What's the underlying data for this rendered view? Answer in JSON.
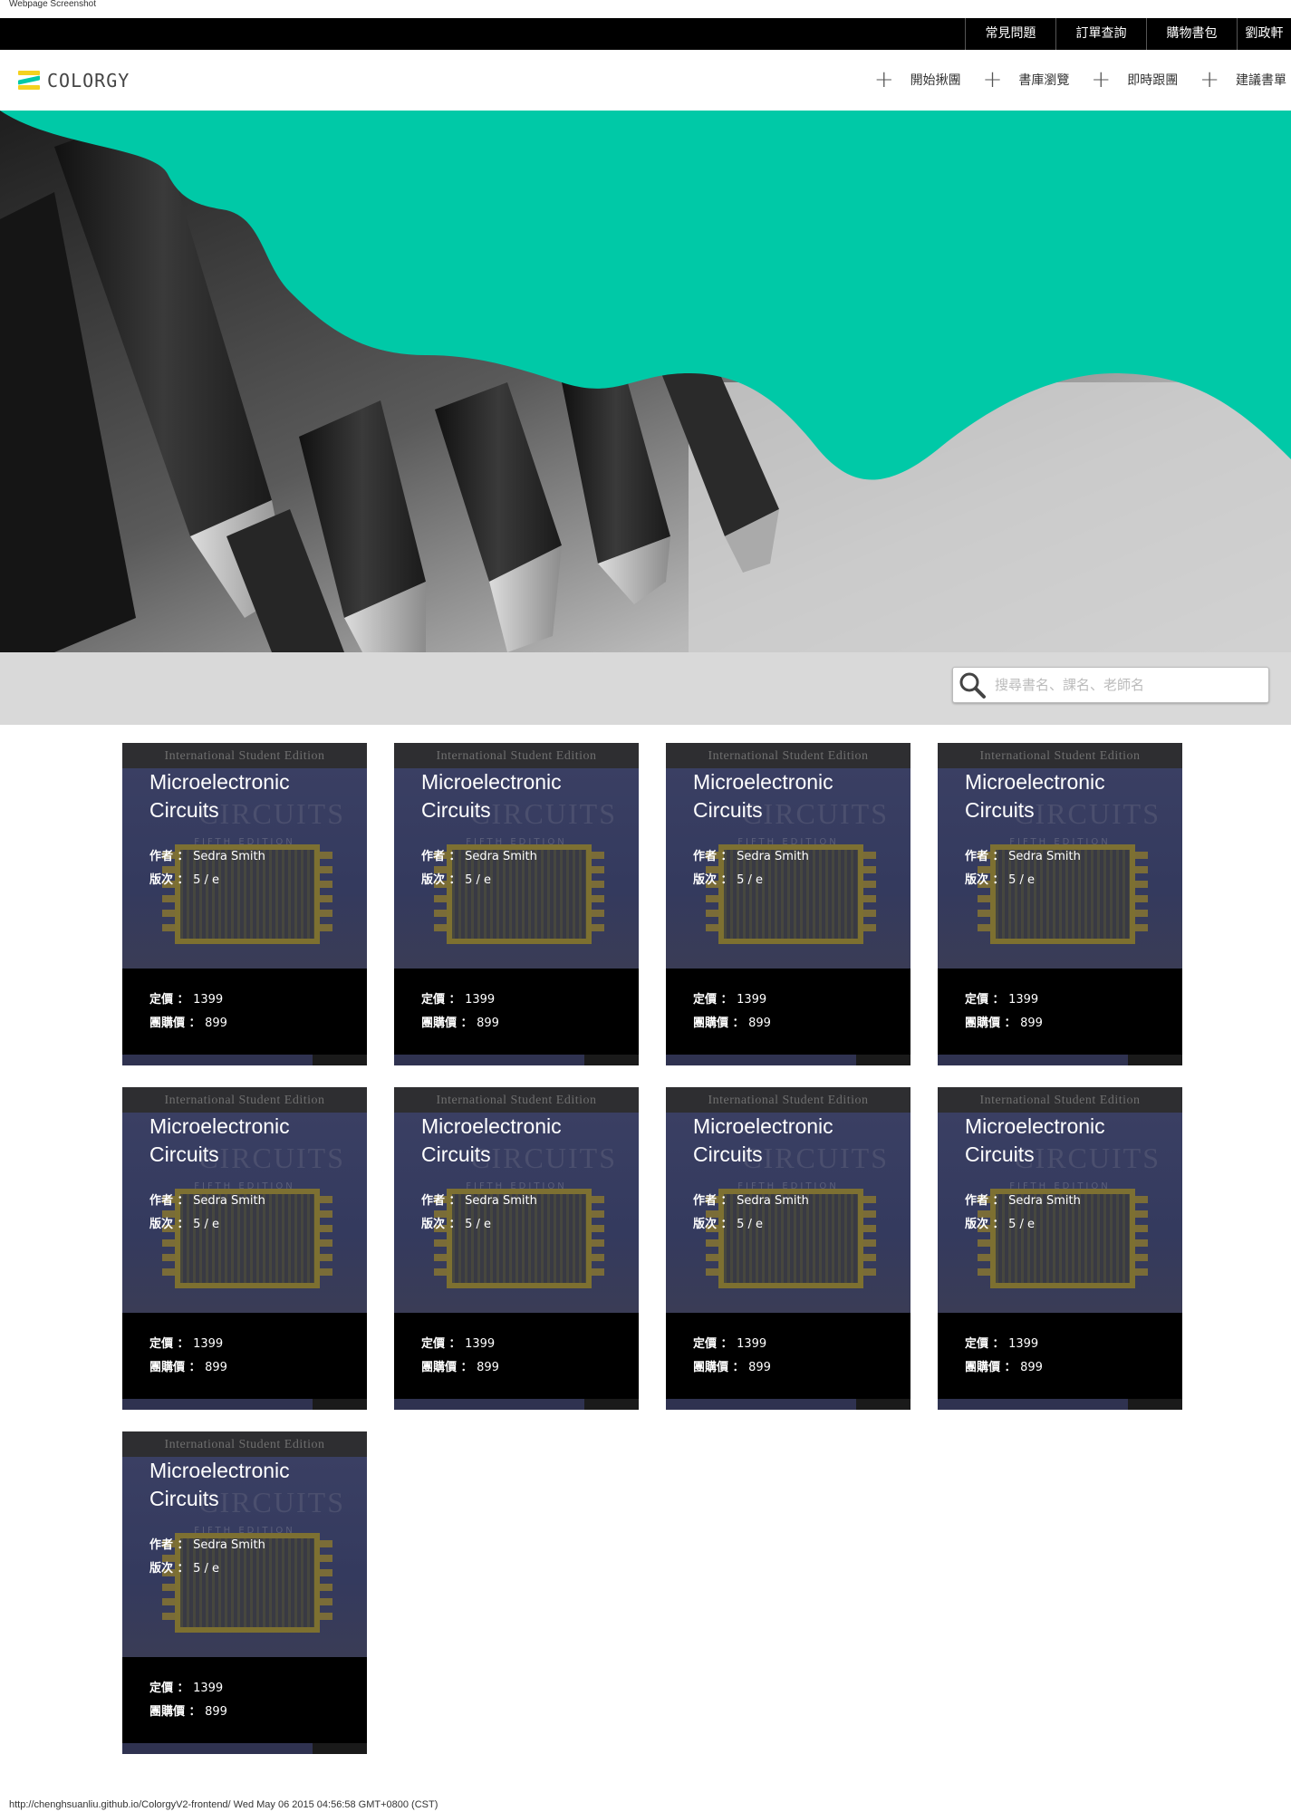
{
  "print_header": "Webpage Screenshot",
  "topbar": {
    "links": [
      "常見問題",
      "訂單查詢",
      "購物書包",
      "劉政軒"
    ]
  },
  "navbar": {
    "logo_text": "COLORGY",
    "menu": [
      "開始揪團",
      "書庫瀏覽",
      "即時跟團",
      "建議書單"
    ]
  },
  "colors": {
    "accent": "#00c9a7",
    "logo_yellow": "#f4d21f",
    "search_band": "#d9d9d9"
  },
  "search": {
    "placeholder": "搜尋書名、課名、老師名"
  },
  "books": [
    {
      "title": "Microelectronic Circuits",
      "author_label": "作者 ：",
      "author": "Sedra Smith",
      "edition_label": "版次 ：",
      "edition": "5 / e",
      "list_price_label": "定價 ：",
      "list_price": "1399",
      "group_price_label": "團購價 ：",
      "group_price": "899",
      "cover_edition": "International Student Edition",
      "cover_title": "CIRCUITS",
      "cover_sub": "FIFTH EDITION"
    },
    {
      "title": "Microelectronic Circuits",
      "author_label": "作者 ：",
      "author": "Sedra Smith",
      "edition_label": "版次 ：",
      "edition": "5 / e",
      "list_price_label": "定價 ：",
      "list_price": "1399",
      "group_price_label": "團購價 ：",
      "group_price": "899",
      "cover_edition": "International Student Edition",
      "cover_title": "CIRCUITS",
      "cover_sub": "FIFTH EDITION"
    },
    {
      "title": "Microelectronic Circuits",
      "author_label": "作者 ：",
      "author": "Sedra Smith",
      "edition_label": "版次 ：",
      "edition": "5 / e",
      "list_price_label": "定價 ：",
      "list_price": "1399",
      "group_price_label": "團購價 ：",
      "group_price": "899",
      "cover_edition": "International Student Edition",
      "cover_title": "CIRCUITS",
      "cover_sub": "FIFTH EDITION"
    },
    {
      "title": "Microelectronic Circuits",
      "author_label": "作者 ：",
      "author": "Sedra Smith",
      "edition_label": "版次 ：",
      "edition": "5 / e",
      "list_price_label": "定價 ：",
      "list_price": "1399",
      "group_price_label": "團購價 ：",
      "group_price": "899",
      "cover_edition": "International Student Edition",
      "cover_title": "CIRCUITS",
      "cover_sub": "FIFTH EDITION"
    },
    {
      "title": "Microelectronic Circuits",
      "author_label": "作者 ：",
      "author": "Sedra Smith",
      "edition_label": "版次 ：",
      "edition": "5 / e",
      "list_price_label": "定價 ：",
      "list_price": "1399",
      "group_price_label": "團購價 ：",
      "group_price": "899",
      "cover_edition": "International Student Edition",
      "cover_title": "CIRCUITS",
      "cover_sub": "FIFTH EDITION"
    },
    {
      "title": "Microelectronic Circuits",
      "author_label": "作者 ：",
      "author": "Sedra Smith",
      "edition_label": "版次 ：",
      "edition": "5 / e",
      "list_price_label": "定價 ：",
      "list_price": "1399",
      "group_price_label": "團購價 ：",
      "group_price": "899",
      "cover_edition": "International Student Edition",
      "cover_title": "CIRCUITS",
      "cover_sub": "FIFTH EDITION"
    },
    {
      "title": "Microelectronic Circuits",
      "author_label": "作者 ：",
      "author": "Sedra Smith",
      "edition_label": "版次 ：",
      "edition": "5 / e",
      "list_price_label": "定價 ：",
      "list_price": "1399",
      "group_price_label": "團購價 ：",
      "group_price": "899",
      "cover_edition": "International Student Edition",
      "cover_title": "CIRCUITS",
      "cover_sub": "FIFTH EDITION"
    },
    {
      "title": "Microelectronic Circuits",
      "author_label": "作者 ：",
      "author": "Sedra Smith",
      "edition_label": "版次 ：",
      "edition": "5 / e",
      "list_price_label": "定價 ：",
      "list_price": "1399",
      "group_price_label": "團購價 ：",
      "group_price": "899",
      "cover_edition": "International Student Edition",
      "cover_title": "CIRCUITS",
      "cover_sub": "FIFTH EDITION"
    },
    {
      "title": "Microelectronic Circuits",
      "author_label": "作者 ：",
      "author": "Sedra Smith",
      "edition_label": "版次 ：",
      "edition": "5 / e",
      "list_price_label": "定價 ：",
      "list_price": "1399",
      "group_price_label": "團購價 ：",
      "group_price": "899",
      "cover_edition": "International Student Edition",
      "cover_title": "CIRCUITS",
      "cover_sub": "FIFTH EDITION"
    }
  ],
  "print_footer": "http://chenghsuanliu.github.io/ColorgyV2-frontend/ Wed May 06 2015 04:56:58 GMT+0800 (CST)"
}
